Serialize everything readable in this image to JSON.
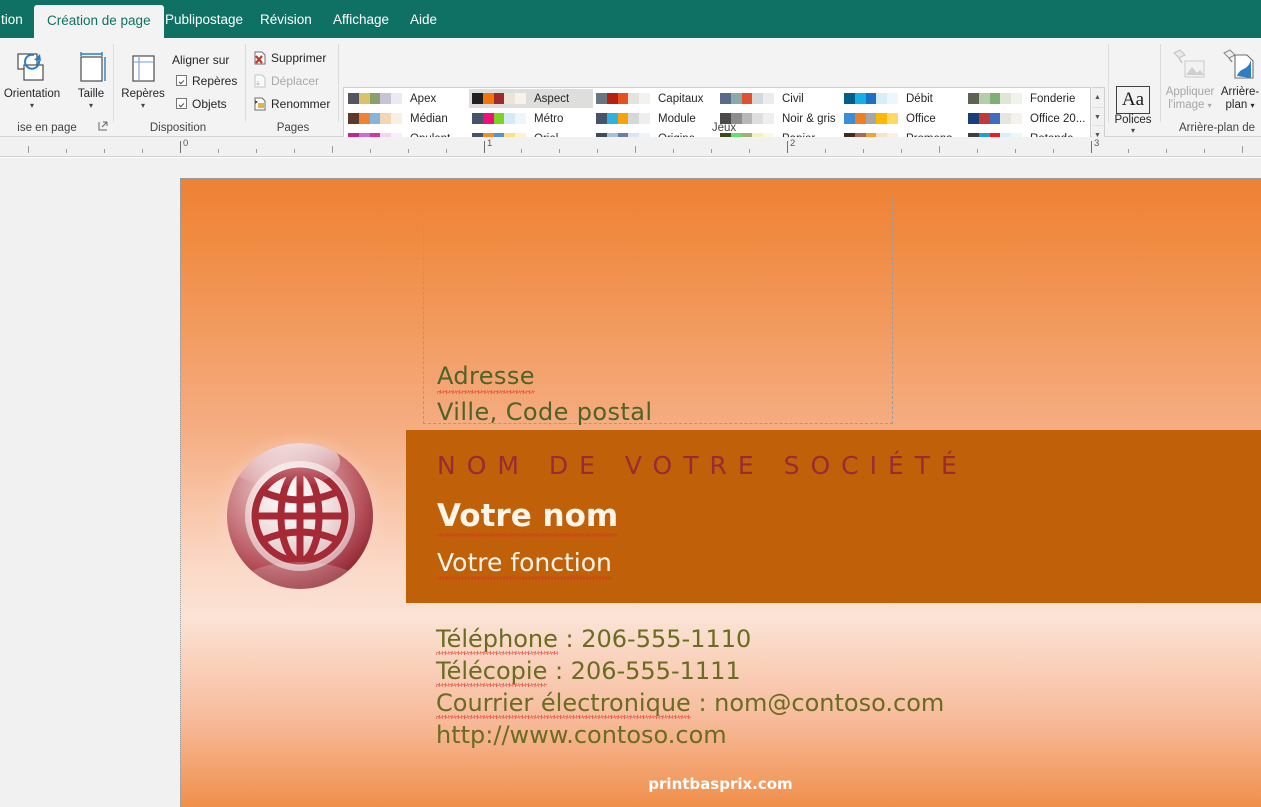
{
  "ribbon": {
    "tabs": [
      {
        "label": "tion",
        "active": false
      },
      {
        "label": "Création de page",
        "active": true
      },
      {
        "label": "Publipostage",
        "active": false
      },
      {
        "label": "Révision",
        "active": false
      },
      {
        "label": "Affichage",
        "active": false
      },
      {
        "label": "Aide",
        "active": false
      }
    ],
    "groups": {
      "page_setup": "ise en page",
      "layout": "Disposition",
      "pages": "Pages",
      "schemes": "Jeux",
      "background": "Arrière-plan de"
    },
    "buttons": {
      "orientation": "Orientation",
      "size": "Taille",
      "guides": "Repères",
      "fonts": "Polices",
      "apply_image_l1": "Appliquer",
      "apply_image_l2": "l'image",
      "background_l1": "Arrière-",
      "background_l2": "plan",
      "arrow": "▾"
    },
    "layout_group": {
      "align_to": "Aligner sur",
      "guides_checkbox": "Repères",
      "objects_checkbox": "Objets"
    },
    "pages_group": {
      "delete": "Supprimer",
      "move": "Déplacer",
      "rename": "Renommer"
    },
    "color_schemes": [
      {
        "name": "Apex",
        "selected": false,
        "colors": [
          "#54565f",
          "#d9c36a",
          "#8aa06c",
          "#c6c4d6",
          "#eceaf0"
        ]
      },
      {
        "name": "Médian",
        "selected": false,
        "colors": [
          "#5c3b2a",
          "#ef8436",
          "#85b4dd",
          "#f1d7b2",
          "#faf0e2"
        ]
      },
      {
        "name": "Opulent",
        "selected": false,
        "colors": [
          "#b82a8d",
          "#c46fd1",
          "#d1399a",
          "#f3d6e8",
          "#fbeef5"
        ]
      },
      {
        "name": "Aspect",
        "selected": true,
        "colors": [
          "#231f20",
          "#f2760c",
          "#9e2b2b",
          "#ece4d6",
          "#f7f3ea"
        ]
      },
      {
        "name": "Métro",
        "selected": false,
        "colors": [
          "#46546a",
          "#ef0f7a",
          "#7ed321",
          "#d7e9f5",
          "#eef6fb"
        ]
      },
      {
        "name": "Oriel",
        "selected": false,
        "colors": [
          "#46546a",
          "#f28c28",
          "#5b8fd4",
          "#fbe08a",
          "#fdf3cf"
        ]
      },
      {
        "name": "Capitaux",
        "selected": false,
        "colors": [
          "#6c7582",
          "#b72113",
          "#e8511e",
          "#e6e3df",
          "#f4f2ef"
        ]
      },
      {
        "name": "Module",
        "selected": false,
        "colors": [
          "#46546a",
          "#2fb3de",
          "#f6a208",
          "#d5d7d8",
          "#eceeef"
        ]
      },
      {
        "name": "Origine",
        "selected": false,
        "colors": [
          "#3f4a5b",
          "#a7c2d8",
          "#6b7fa6",
          "#dbe7ef",
          "#eef4f8"
        ]
      },
      {
        "name": "Civil",
        "selected": false,
        "colors": [
          "#5a6a8a",
          "#8aa9a8",
          "#e0512f",
          "#d5d9dd",
          "#eaedef"
        ]
      },
      {
        "name": "Noir & gris",
        "selected": false,
        "colors": [
          "#4a4a4a",
          "#8d8d8d",
          "#b7b7b7",
          "#dedede",
          "#efefef"
        ]
      },
      {
        "name": "Papier",
        "selected": false,
        "colors": [
          "#3d4a1e",
          "#66dd6f",
          "#9fb07a",
          "#f4f3c0",
          "#fbfadd"
        ]
      },
      {
        "name": "Débit",
        "selected": false,
        "colors": [
          "#005f84",
          "#16aee3",
          "#1c71c4",
          "#d7edf8",
          "#ecf6fc"
        ]
      },
      {
        "name": "Office",
        "selected": false,
        "colors": [
          "#3a8fd4",
          "#ef7f26",
          "#a6a6a6",
          "#fcb900",
          "#ffd866"
        ]
      },
      {
        "name": "Promena...",
        "selected": false,
        "colors": [
          "#3d2b22",
          "#a8685c",
          "#f0a23a",
          "#f2e4cf",
          "#f9f1e4"
        ]
      },
      {
        "name": "Fonderie",
        "selected": false,
        "colors": [
          "#5d6353",
          "#b7cbad",
          "#7faf72",
          "#dee7d6",
          "#eff3ec"
        ]
      },
      {
        "name": "Office 20...",
        "selected": false,
        "colors": [
          "#15407a",
          "#c23a38",
          "#3c6dbe",
          "#e8e5dc",
          "#f4f2ec"
        ]
      },
      {
        "name": "Rotonde",
        "selected": false,
        "colors": [
          "#3e3e42",
          "#1ba2d0",
          "#ee1c24",
          "#d6eff8",
          "#ecf7fc"
        ]
      }
    ],
    "scroll": {
      "up": "▲",
      "down": "▼",
      "more": "▼"
    }
  },
  "ruler": {
    "numbers": [
      "0",
      "1",
      "2",
      "3"
    ]
  },
  "document": {
    "address": {
      "line1": "Adresse",
      "line2": "Ville, Code postal"
    },
    "banner": {
      "company": "NOM DE VOTRE SOCIÉTÉ",
      "name": "Votre nom",
      "role": "Votre fonction",
      "background": "#c06009",
      "company_color": "#9c2a33",
      "text_color": "#fdf5ea"
    },
    "contact": [
      "Téléphone : 206-555-1110",
      "Télécopie : 206-555-1111",
      "Courrier électronique : nom@contoso.com",
      "http://www.contoso.com"
    ],
    "contact_color": "#6a6c22",
    "footer": "printbasprix.com",
    "page_gradient_top": "#ee8134",
    "page_gradient_mid": "#fbe3d5",
    "page_gradient_bottom": "#f08f4a",
    "logo": "globe-icon"
  }
}
